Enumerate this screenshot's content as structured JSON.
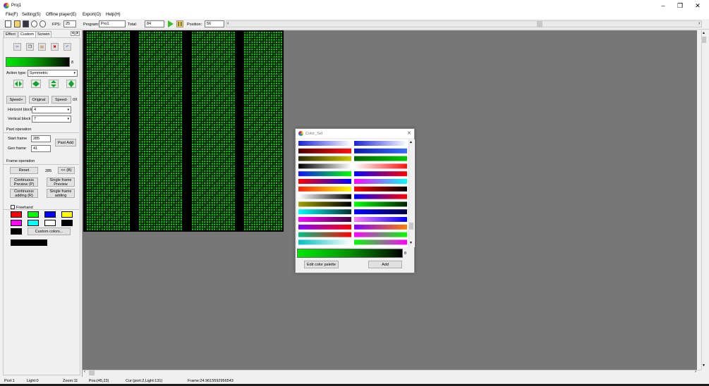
{
  "window": {
    "title": "Proj1"
  },
  "menu": [
    "File(F)",
    "Setting(S)",
    "Offline player(E)",
    "Export(O)",
    "Help(H)"
  ],
  "toolbar": {
    "fps_label": "FPS:",
    "fps_value": "25",
    "program_label": "Program:",
    "program_value": "Pro1",
    "total_label": "Total:",
    "total_value": "84",
    "position_label": "Position:",
    "position_value": "56"
  },
  "tabs": [
    "Effect",
    "Custom",
    "Screen"
  ],
  "left": {
    "color_strip_count": "8",
    "action_type_label": "Action type:",
    "action_type_value": "Symmetric",
    "speed_plus": "Speed+",
    "original": "Original",
    "speed_minus": "Speed-",
    "speed_value": "0X",
    "horizontal_label": "Horizonl block",
    "horizontal_value": "4",
    "vertical_label": "Vertical block",
    "vertical_value": "7",
    "paste_section": "Past operation",
    "start_frame_label": "Start frame",
    "start_frame_value": "285",
    "gen_frame_label": "Gen frame",
    "gen_frame_value": "41",
    "past_add": "Past Add",
    "frame_section": "Frame operation",
    "reset": "Reset",
    "frame_count": "285",
    "back_btn": "<< (B)",
    "cont_preview": "Continuous Preview (P)",
    "single_preview": "Single frame Preview",
    "cont_adding": "Continuous adding (R)",
    "single_adding": "Single frame adding",
    "freehand": "Freehand",
    "custom_colors": "Custom colors...",
    "swatches": [
      "#ff0000",
      "#00ff00",
      "#0000ff",
      "#ffff00",
      "#ff00ff",
      "#00ffff",
      "#ffffff",
      "#000000"
    ]
  },
  "status": {
    "port": "Port:1",
    "light": "Light:0",
    "zoom": "Zoom:11",
    "pos": "Pos:(45,23)",
    "cur": "Cur:(port:2,Light:131)",
    "frame": "Frame:24.9615592956543"
  },
  "dialog": {
    "title": "Color_Sel",
    "count": "8",
    "edit_btn": "Edit color palette",
    "add_btn": "Add"
  },
  "icons": {
    "app": "color-wheel-icon",
    "new": "new-file-icon",
    "open": "open-folder-icon",
    "save": "save-icon",
    "play": "play-icon",
    "pause": "pause-icon"
  }
}
